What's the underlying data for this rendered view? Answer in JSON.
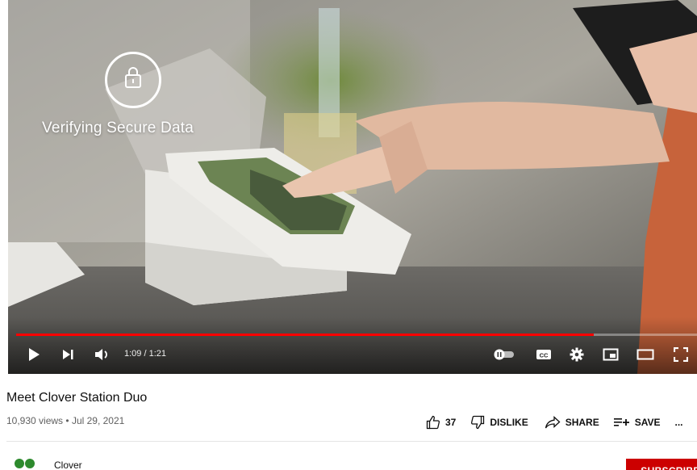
{
  "player": {
    "overlay_text": "Verifying Secure Data",
    "current_time": "1:09",
    "duration": "1:21",
    "time_display": "1:09 / 1:21",
    "progress": 0.848,
    "autoplay_on": false,
    "colors": {
      "progress": "#ff0000",
      "track": "rgba(255,255,255,0.35)"
    },
    "icons": [
      "play-icon",
      "next-icon",
      "volume-icon",
      "autoplay-toggle-icon",
      "captions-icon",
      "settings-icon",
      "miniplayer-icon",
      "theater-icon",
      "fullscreen-icon"
    ]
  },
  "video": {
    "title": "Meet Clover Station Duo",
    "views": "10,930 views",
    "separator": "•",
    "date": "Jul 29, 2021"
  },
  "actions": {
    "like_count": "37",
    "dislike_label": "DISLIKE",
    "share_label": "SHARE",
    "save_label": "SAVE",
    "more_label": "..."
  },
  "channel": {
    "name": "Clover",
    "subscribe_label": "SUBSCRIBE",
    "brand_color": "#2d8a2d"
  }
}
